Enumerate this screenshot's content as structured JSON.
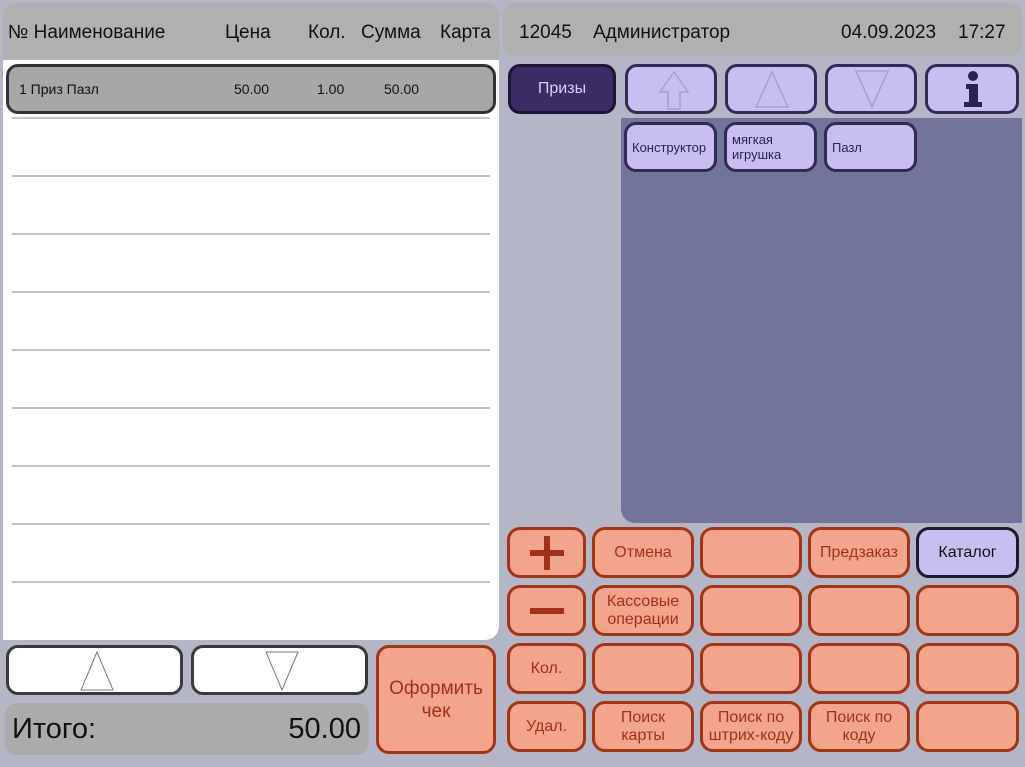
{
  "receipt": {
    "headers": {
      "name": "№ Наименование",
      "price": "Цена",
      "qty": "Кол.",
      "sum": "Сумма",
      "card": "Карта"
    },
    "rows": [
      {
        "name": "1 Приз Пазл",
        "price": "50.00",
        "qty": "1.00",
        "sum": "50.00",
        "card": ""
      }
    ],
    "total_label": "Итого:",
    "total_value": "50.00",
    "checkout_label": "Оформить чек"
  },
  "topbar": {
    "id": "12045",
    "user": "Администратор",
    "date": "04.09.2023",
    "time": "17:27"
  },
  "category": {
    "active_label": "Призы"
  },
  "products": [
    "Конструктор",
    "мягкая игрушка",
    "Пазл"
  ],
  "keypad": {
    "cancel": "Отмена",
    "preorder": "Предзаказ",
    "catalog": "Каталог",
    "cash_ops": "Кассовые операции",
    "qty": "Кол.",
    "delete": "Удал.",
    "search_card": "Поиск карты",
    "search_barcode": "Поиск по штрих-коду",
    "search_code": "Поиск по коду"
  },
  "icons": [
    "arrow-up-icon",
    "arrow-down-icon",
    "info-icon",
    "plus-icon",
    "minus-icon"
  ],
  "colors": {
    "salmon": "#f3a48c",
    "salmon_border": "#a13518",
    "lavender": "#c8bef0",
    "dark_purple": "#3a2d66",
    "grid_bg": "#727599"
  }
}
